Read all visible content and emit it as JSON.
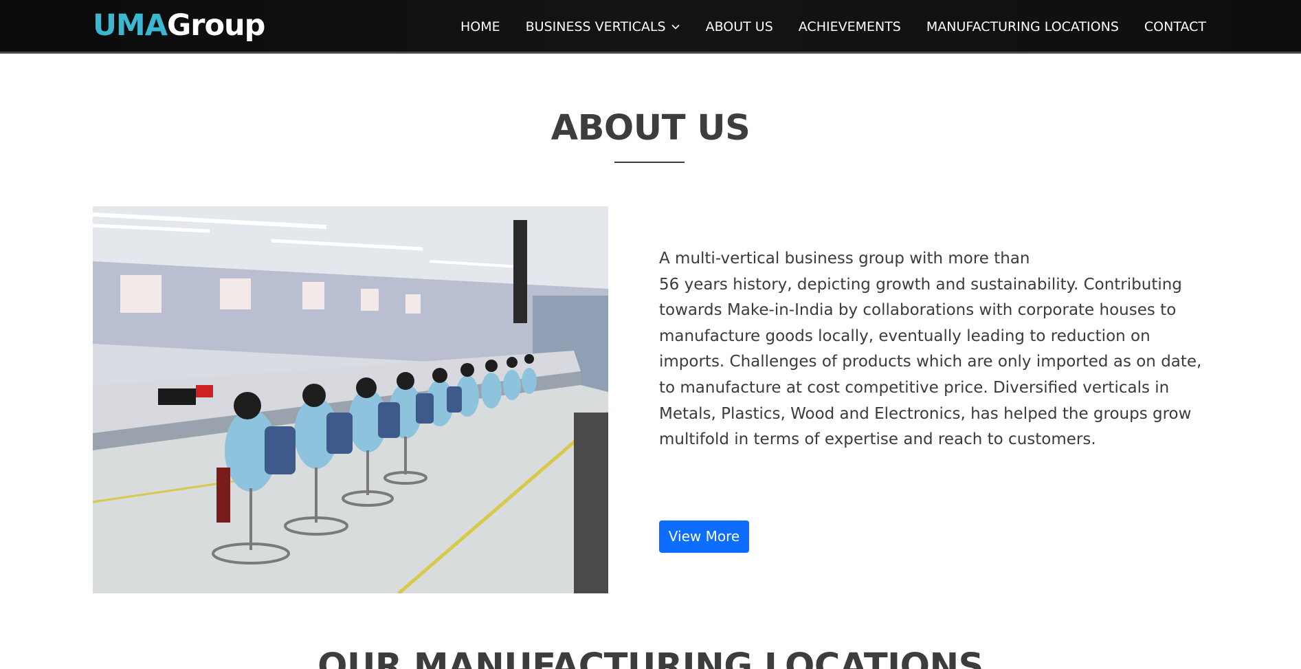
{
  "brand": {
    "logo_part1": "UMA",
    "logo_part2": "Group"
  },
  "nav": {
    "items": [
      {
        "label": "HOME"
      },
      {
        "label": "BUSINESS VERTICALS",
        "has_dropdown": true
      },
      {
        "label": "ABOUT US"
      },
      {
        "label": "ACHIEVEMENTS"
      },
      {
        "label": "MANUFACTURING LOCATIONS"
      },
      {
        "label": "CONTACT"
      }
    ]
  },
  "about": {
    "title": "ABOUT US",
    "line1": "A multi-vertical business group with more than",
    "body": "56 years history, depicting growth and sustainability. Contributing towards Make-in-India by collaborations with corporate houses to manufacture goods locally, eventually leading to reduction on imports. Challenges of products which are only imported as on date, to manufacture at cost competitive price. Diversified verticals in Metals, Plastics, Wood and Electronics, has helped the groups grow multifold in terms of expertise and reach to customers.",
    "button_label": "View More"
  },
  "next_section": {
    "title": "OUR MANUFACTURING LOCATIONS"
  },
  "colors": {
    "logo_accent": "#3bb7d0",
    "navbar_bg": "#0f0f0f",
    "button_bg": "#0d6efd",
    "heading_text": "#3d3d3d"
  },
  "icons": {
    "dropdown": "chevron-down-icon"
  }
}
